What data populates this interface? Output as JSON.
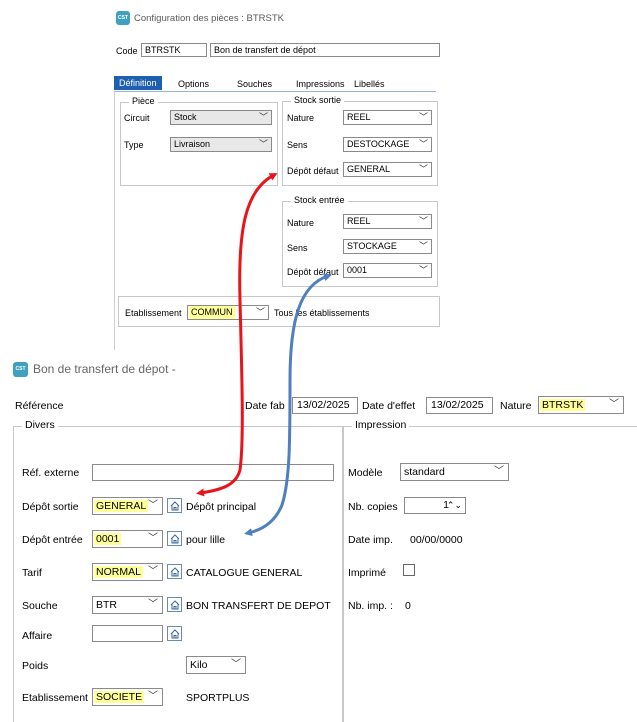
{
  "config_window": {
    "title": "Configuration des pièces : BTRSTK",
    "code_label": "Code",
    "code_value": "BTRSTK",
    "code_desc": "Bon de transfert de dépot",
    "tabs": [
      "Définition",
      "Options",
      "Souches",
      "Impressions",
      "Libellés"
    ],
    "piece": {
      "title": "Pièce",
      "circuit_label": "Circuit",
      "circuit_value": "Stock",
      "type_label": "Type",
      "type_value": "Livraison"
    },
    "stock_sortie": {
      "title": "Stock sortie",
      "nature_label": "Nature",
      "nature_value": "REEL",
      "sens_label": "Sens",
      "sens_value": "DESTOCKAGE",
      "depot_label": "Dépôt défaut",
      "depot_value": "GENERAL"
    },
    "stock_entree": {
      "title": "Stock entrée",
      "nature_label": "Nature",
      "nature_value": "REEL",
      "sens_label": "Sens",
      "sens_value": "STOCKAGE",
      "depot_label": "Dépôt défaut",
      "depot_value": "0001"
    },
    "etab_label": "Etablissement",
    "etab_value": "COMMUN",
    "etab_desc": "Tous les établissements"
  },
  "doc_window": {
    "title": "Bon de transfert de dépot -",
    "reference_label": "Référence",
    "date_fab_label": "Date fab",
    "date_fab_value": "13/02/2025",
    "date_effet_label": "Date d'effet",
    "date_effet_value": "13/02/2025",
    "nature_label": "Nature",
    "nature_value": "BTRSTK",
    "divers": {
      "title": "Divers",
      "ref_externe_label": "Réf. externe",
      "ref_externe_value": "",
      "depot_sortie_label": "Dépôt sortie",
      "depot_sortie_value": "GENERAL",
      "depot_sortie_desc": "Dépôt principal",
      "depot_entree_label": "Dépôt entrée",
      "depot_entree_value": "0001",
      "depot_entree_desc": "pour lille",
      "tarif_label": "Tarif",
      "tarif_value": "NORMAL",
      "tarif_desc": "CATALOGUE GENERAL",
      "souche_label": "Souche",
      "souche_value": "BTR",
      "souche_desc": "BON  TRANSFERT DE DEPOT",
      "affaire_label": "Affaire",
      "affaire_value": "",
      "poids_label": "Poids",
      "poids_unit": "Kilo",
      "etab_label": "Etablissement",
      "etab_value": "SOCIETE",
      "etab_desc": "SPORTPLUS"
    },
    "impression": {
      "title": "Impression",
      "modele_label": "Modèle",
      "modele_value": "standard",
      "nb_copies_label": "Nb. copies",
      "nb_copies_value": "1",
      "date_imp_label": "Date imp.",
      "date_imp_value": "00/00/0000",
      "imprime_label": "Imprimé",
      "imprime_checked": false,
      "nb_imp_label": "Nb. imp. :",
      "nb_imp_value": "0"
    }
  },
  "colors": {
    "tab_active": "#1f5fb0",
    "highlight": "#ffff99",
    "arrow_red": "#e8141b",
    "arrow_blue": "#4f7fbf"
  }
}
